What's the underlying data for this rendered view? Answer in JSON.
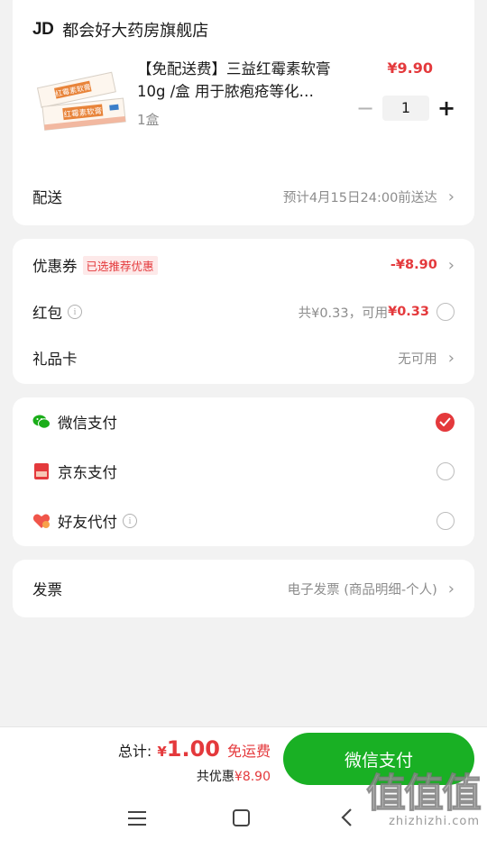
{
  "store": {
    "logo": "JD",
    "name": "都会好大药房旗舰店"
  },
  "product": {
    "title": "【免配送费】三益红霉素软膏10g /盒 用于脓疱疮等化…",
    "qty_label": "1盒",
    "price": "¥9.90",
    "quantity": "1",
    "image_text_1": "红霉素软膏",
    "image_text_2": "红霉素软膏"
  },
  "delivery": {
    "label": "配送",
    "value": "预计4月15日24:00前送达"
  },
  "coupon": {
    "label": "优惠券",
    "tag": "已选推荐优惠",
    "value": "-¥8.90"
  },
  "redpacket": {
    "label": "红包",
    "total_prefix": "共¥0.33，可用",
    "available": "¥0.33"
  },
  "giftcard": {
    "label": "礼品卡",
    "value": "无可用"
  },
  "payments": [
    {
      "label": "微信支付",
      "icon": "wechat-icon",
      "selected": true
    },
    {
      "label": "京东支付",
      "icon": "jdpay-icon",
      "selected": false
    },
    {
      "label": "好友代付",
      "icon": "friend-pay-icon",
      "selected": false
    }
  ],
  "invoice": {
    "label": "发票",
    "value": "电子发票 (商品明细-个人)"
  },
  "footer": {
    "total_label": "总计:",
    "currency": "¥",
    "total_amount": "1.00",
    "free_shipping": "免运费",
    "discount_prefix": "共优惠",
    "discount_value": "¥8.90",
    "pay_button": "微信支付"
  },
  "watermark": {
    "big": "值值值",
    "small": "zhizhizhi.com"
  },
  "colors": {
    "accent_red": "#e4393c",
    "wechat_green": "#19b024"
  }
}
